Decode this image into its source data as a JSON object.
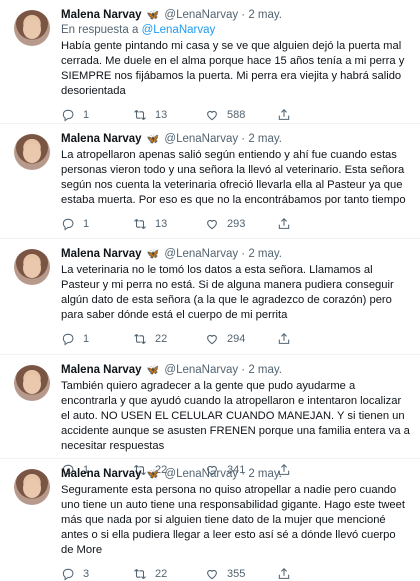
{
  "tweets": [
    {
      "name": "Malena Narvay",
      "handle": "@LenaNarvay",
      "date": "2 may.",
      "reply_label": "En respuesta a",
      "reply_mention": "@LenaNarvay",
      "text": "Había gente pintando mi casa y se ve que alguien dejó la puerta mal cerrada. Me duele en el alma porque hace 15 años tenía a mi perra y SIEMPRE nos fijábamos la puerta. Mi perra era viejita y habrá salido desorientada",
      "replies": "1",
      "retweets": "13",
      "likes": "588"
    },
    {
      "name": "Malena Narvay",
      "handle": "@LenaNarvay",
      "date": "2 may.",
      "text": "La atropellaron apenas salió según entiendo y ahí fue cuando estas personas vieron todo y una señora la llevó al veterinario. Esta señora según nos cuenta la veterinaria ofreció llevarla ella al Pasteur ya que estaba muerta. Por eso es que no la encontrábamos por tanto tiempo",
      "replies": "1",
      "retweets": "13",
      "likes": "293"
    },
    {
      "name": "Malena Narvay",
      "handle": "@LenaNarvay",
      "date": "2 may.",
      "text": "La veterinaria no le tomó los datos a esta señora. Llamamos al Pasteur y mi perra no está. Si de alguna manera pudiera conseguir algún dato de esta señora (a la que le agradezco de corazón) pero para saber dónde está el cuerpo de mi perrita",
      "replies": "1",
      "retweets": "22",
      "likes": "294"
    },
    {
      "name": "Malena Narvay",
      "handle": "@LenaNarvay",
      "date": "2 may.",
      "text": "También quiero agradecer a la gente que pudo ayudarme a encontrarla y que ayudó cuando la atropellaron e intentaron localizar el auto. NO USEN EL CELULAR CUANDO MANEJAN. Y si tienen un accidente aunque se asusten FRENEN porque una familia entera va a necesitar respuestas",
      "replies": "1",
      "retweets": "22",
      "likes": "341"
    },
    {
      "name": "Malena Narvay",
      "handle": "@LenaNarvay",
      "date": "2 may.",
      "text": "Seguramente esta persona no quiso atropellar a nadie pero cuando uno tiene un auto tiene una responsabilidad gigante. Hago este tweet más que nada por si alguien tiene dato de la mujer que mencioné antes o si ella pudiera llegar a leer esto así sé a dónde llevó cuerpo de More",
      "replies": "3",
      "retweets": "22",
      "likes": "355"
    }
  ],
  "icons": {
    "verified_emoji": "butterfly-icon",
    "reply": "reply-icon",
    "retweet": "retweet-icon",
    "like": "heart-icon",
    "share": "share-icon"
  },
  "colors": {
    "accent": "#1d9bf0",
    "muted": "#536471",
    "text": "#0f1419"
  }
}
